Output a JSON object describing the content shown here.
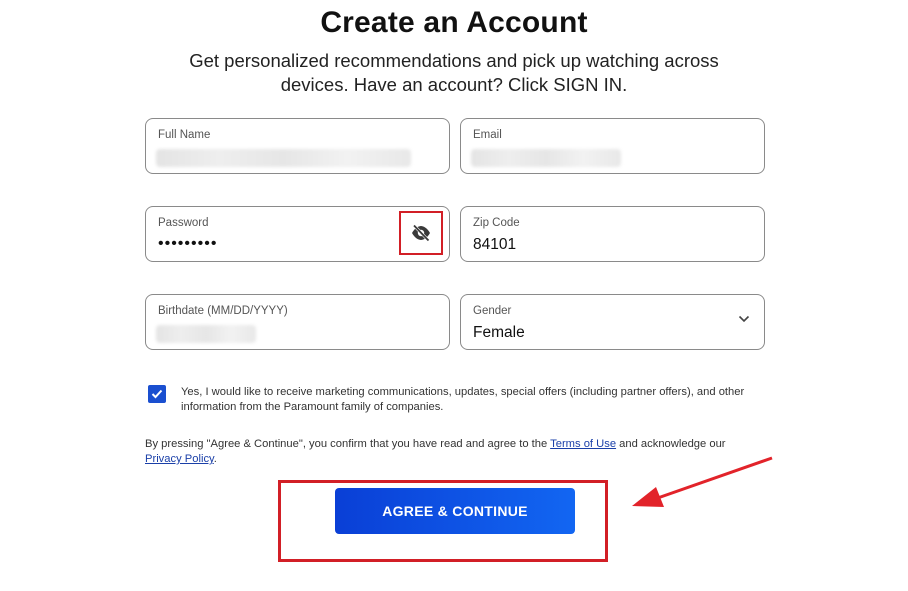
{
  "header": {
    "title": "Create an Account",
    "subtitle": "Get personalized recommendations and pick up watching across devices. Have an account? Click SIGN IN."
  },
  "form": {
    "full_name": {
      "label": "Full Name",
      "value": ""
    },
    "email": {
      "label": "Email",
      "value": ""
    },
    "password": {
      "label": "Password",
      "value": "•••••••••",
      "toggle_icon": "eye-slash-icon"
    },
    "zip": {
      "label": "Zip Code",
      "value": "84101"
    },
    "birthdate": {
      "label": "Birthdate (MM/DD/YYYY)",
      "value": ""
    },
    "gender": {
      "label": "Gender",
      "value": "Female",
      "icon": "chevron-down-icon"
    }
  },
  "marketing_consent": {
    "checked": true,
    "text": "Yes, I would like to receive marketing communications, updates, special offers (including partner offers), and other information from the Paramount family of companies."
  },
  "legal": {
    "prefix": "By pressing \"Agree & Continue\", you confirm that you have read and agree to the ",
    "terms_link": "Terms of Use",
    "middle": " and acknowledge our ",
    "privacy_link": "Privacy Policy",
    "suffix": "."
  },
  "actions": {
    "agree_label": "AGREE & CONTINUE"
  },
  "colors": {
    "accent": "#1a4fd0",
    "annotation": "#d21f26"
  }
}
